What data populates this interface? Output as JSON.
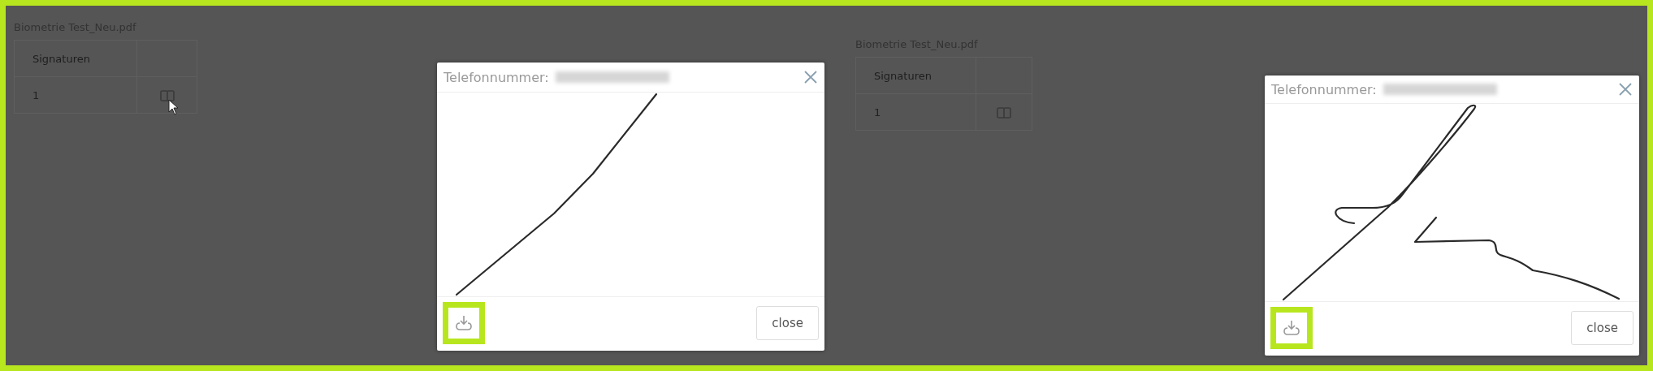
{
  "panels": [
    {
      "file_name": "Biometrie Test_Neu.pdf",
      "table": {
        "columns": [
          "Signaturen"
        ],
        "rows": [
          {
            "cells": [
              "1"
            ]
          }
        ]
      },
      "pointer_on_view": true,
      "dialog": {
        "title": "Telefonnummer:",
        "close_button": "close",
        "download_highlighted": true
      }
    },
    {
      "file_name": "Biometrie Test_Neu.pdf",
      "table": {
        "columns": [
          "Signaturen"
        ],
        "rows": [
          {
            "cells": [
              "1"
            ]
          }
        ]
      },
      "pointer_on_view": false,
      "dialog": {
        "title": "Telefonnummer:",
        "close_button": "close",
        "download_highlighted": true
      }
    }
  ]
}
